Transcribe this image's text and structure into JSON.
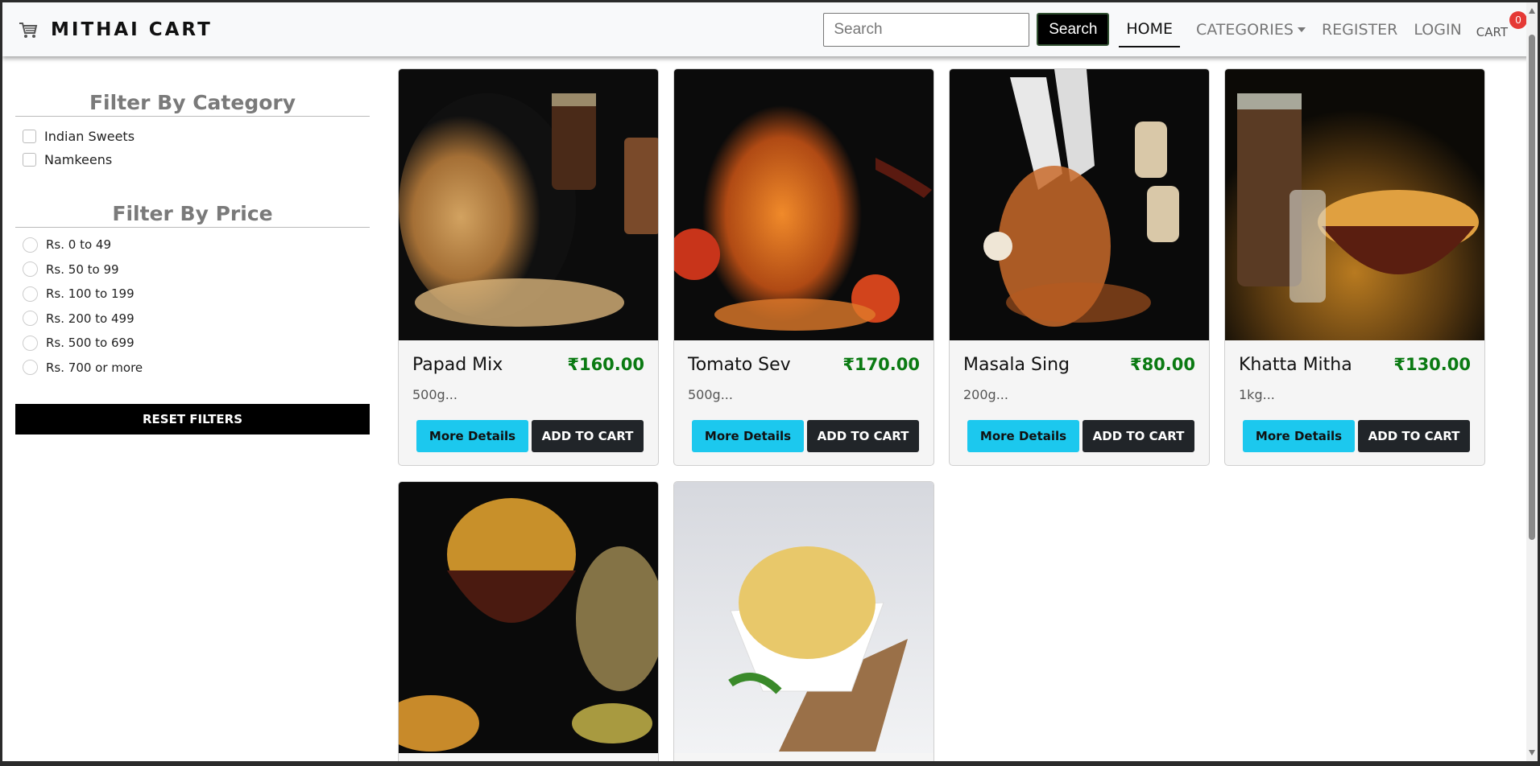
{
  "navbar": {
    "brand": "MITHAI CART",
    "brand_icon": "shopping-cart-icon",
    "search_placeholder": "Search",
    "search_button": "Search",
    "links": {
      "home": "HOME",
      "categories": "CATEGORIES",
      "register": "REGISTER",
      "login": "LOGIN",
      "cart": "CART"
    },
    "cart_count": "0"
  },
  "sidebar": {
    "category_title": "Filter By Category",
    "categories": [
      "Indian Sweets",
      "Namkeens"
    ],
    "price_title": "Filter By Price",
    "prices": [
      "Rs. 0 to 49",
      "Rs. 50 to 99",
      "Rs. 100 to 199",
      "Rs. 200 to 499",
      "Rs. 500 to 699",
      "Rs. 700 or more"
    ],
    "reset_button": "RESET FILTERS"
  },
  "products": [
    {
      "name": "Papad Mix",
      "price": "₹160.00",
      "desc": "500g...",
      "details": "More Details",
      "add": "ADD TO CART"
    },
    {
      "name": "Tomato Sev",
      "price": "₹170.00",
      "desc": "500g...",
      "details": "More Details",
      "add": "ADD TO CART"
    },
    {
      "name": "Masala Sing",
      "price": "₹80.00",
      "desc": "200g...",
      "details": "More Details",
      "add": "ADD TO CART"
    },
    {
      "name": "Khatta Mitha",
      "price": "₹130.00",
      "desc": "1kg...",
      "details": "More Details",
      "add": "ADD TO CART"
    }
  ],
  "colors": {
    "price": "#0a7a12",
    "details_button": "#1cc8ee",
    "cart_button": "#212529",
    "badge": "#e53935"
  }
}
